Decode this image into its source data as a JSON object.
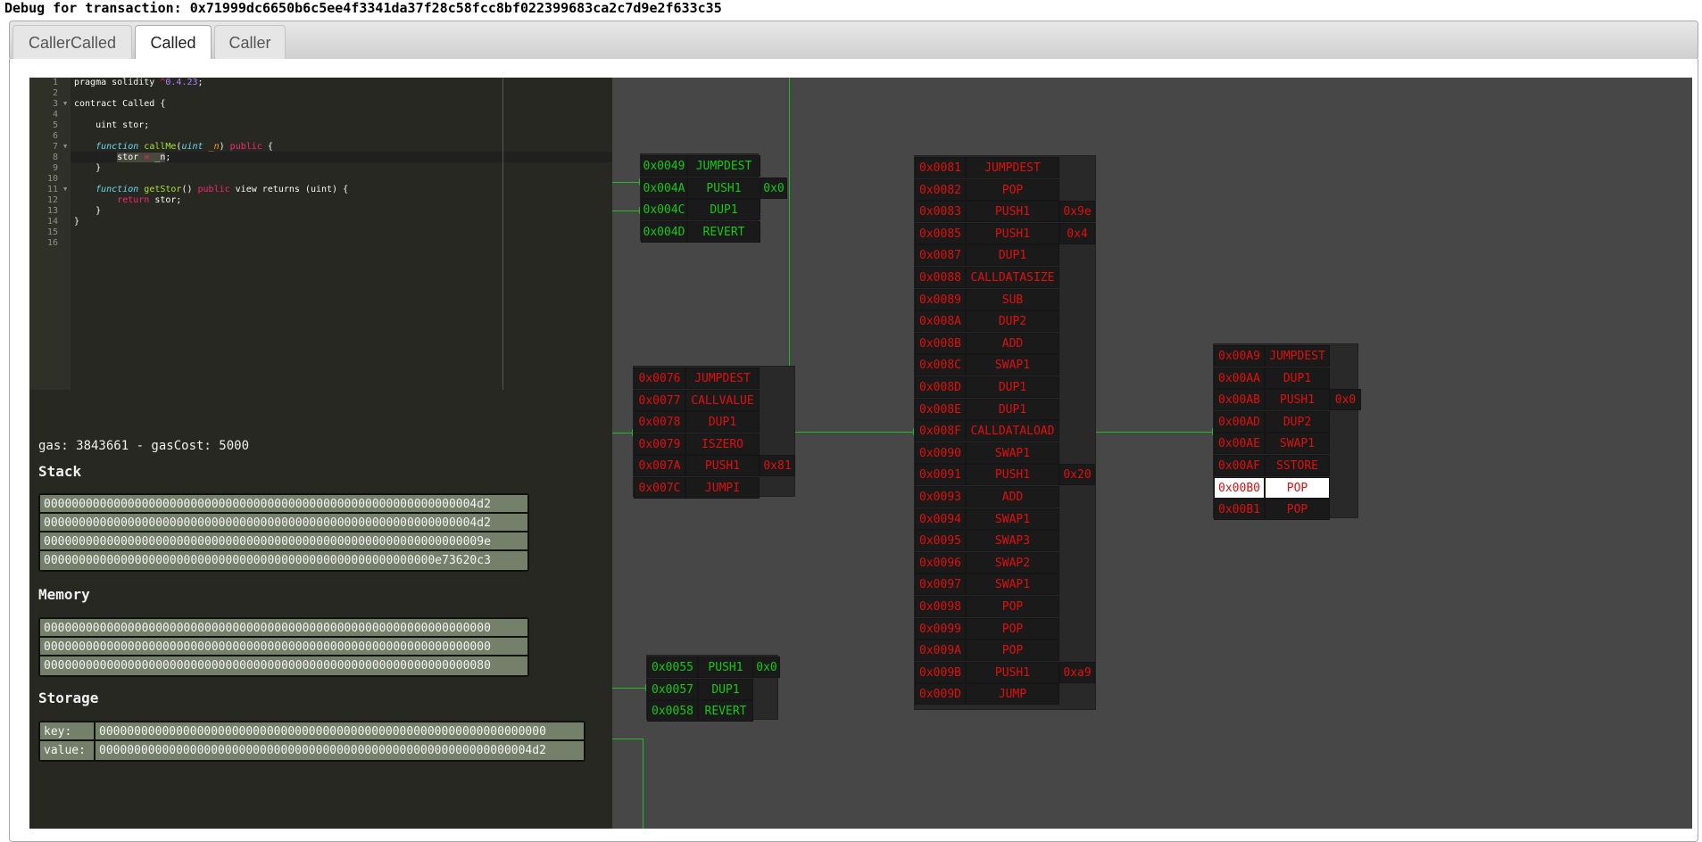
{
  "title": "Debug for transaction: 0x71999dc6650b6c5ee4f3341da37f28c58fcc8bf022399683ca2c7d9e2f633c35",
  "tabs": [
    {
      "label": "CallerCalled",
      "active": false
    },
    {
      "label": "Called",
      "active": true
    },
    {
      "label": "Caller",
      "active": false
    }
  ],
  "editor": {
    "line_numbers": [
      "1",
      "2",
      "3",
      "4",
      "5",
      "6",
      "7",
      "8",
      "9",
      "10",
      "11",
      "12",
      "13",
      "14",
      "15",
      "16"
    ],
    "active_line": 8
  },
  "gas_text": "gas: 3843661 - gasCost: 5000",
  "stack": {
    "heading": "Stack",
    "items": [
      "00000000000000000000000000000000000000000000000000000000000004d2",
      "00000000000000000000000000000000000000000000000000000000000004d2",
      "000000000000000000000000000000000000000000000000000000000000009e",
      "00000000000000000000000000000000000000000000000000000000e73620c3"
    ]
  },
  "memory": {
    "heading": "Memory",
    "items": [
      "0000000000000000000000000000000000000000000000000000000000000000",
      "0000000000000000000000000000000000000000000000000000000000000000",
      "0000000000000000000000000000000000000000000000000000000000000080"
    ]
  },
  "storage": {
    "heading": "Storage",
    "key_label": "key:",
    "key": "0000000000000000000000000000000000000000000000000000000000000000",
    "value_label": "value:",
    "value": "00000000000000000000000000000000000000000000000000000000000004d2"
  },
  "graph": {
    "colors": {
      "visited": "#18c818",
      "current": "#e01010",
      "edge": "#22bb22",
      "background": "#474747"
    },
    "blocks": {
      "b1": [
        {
          "addr": "0x0049",
          "op": "JUMPDEST",
          "arg": ""
        },
        {
          "addr": "0x004A",
          "op": "PUSH1",
          "arg": "0x0"
        },
        {
          "addr": "0x004C",
          "op": "DUP1",
          "arg": ""
        },
        {
          "addr": "0x004D",
          "op": "REVERT",
          "arg": ""
        }
      ],
      "b2": [
        {
          "addr": "0x0076",
          "op": "JUMPDEST",
          "arg": ""
        },
        {
          "addr": "0x0077",
          "op": "CALLVALUE",
          "arg": ""
        },
        {
          "addr": "0x0078",
          "op": "DUP1",
          "arg": ""
        },
        {
          "addr": "0x0079",
          "op": "ISZERO",
          "arg": ""
        },
        {
          "addr": "0x007A",
          "op": "PUSH1",
          "arg": "0x81"
        },
        {
          "addr": "0x007C",
          "op": "JUMPI",
          "arg": ""
        }
      ],
      "b3": [
        {
          "addr": "0x0055",
          "op": "PUSH1",
          "arg": "0x0"
        },
        {
          "addr": "0x0057",
          "op": "DUP1",
          "arg": ""
        },
        {
          "addr": "0x0058",
          "op": "REVERT",
          "arg": ""
        }
      ],
      "b4": [
        {
          "addr": "0x0081",
          "op": "JUMPDEST",
          "arg": ""
        },
        {
          "addr": "0x0082",
          "op": "POP",
          "arg": ""
        },
        {
          "addr": "0x0083",
          "op": "PUSH1",
          "arg": "0x9e"
        },
        {
          "addr": "0x0085",
          "op": "PUSH1",
          "arg": "0x4"
        },
        {
          "addr": "0x0087",
          "op": "DUP1",
          "arg": ""
        },
        {
          "addr": "0x0088",
          "op": "CALLDATASIZE",
          "arg": ""
        },
        {
          "addr": "0x0089",
          "op": "SUB",
          "arg": ""
        },
        {
          "addr": "0x008A",
          "op": "DUP2",
          "arg": ""
        },
        {
          "addr": "0x008B",
          "op": "ADD",
          "arg": ""
        },
        {
          "addr": "0x008C",
          "op": "SWAP1",
          "arg": ""
        },
        {
          "addr": "0x008D",
          "op": "DUP1",
          "arg": ""
        },
        {
          "addr": "0x008E",
          "op": "DUP1",
          "arg": ""
        },
        {
          "addr": "0x008F",
          "op": "CALLDATALOAD",
          "arg": ""
        },
        {
          "addr": "0x0090",
          "op": "SWAP1",
          "arg": ""
        },
        {
          "addr": "0x0091",
          "op": "PUSH1",
          "arg": "0x20"
        },
        {
          "addr": "0x0093",
          "op": "ADD",
          "arg": ""
        },
        {
          "addr": "0x0094",
          "op": "SWAP1",
          "arg": ""
        },
        {
          "addr": "0x0095",
          "op": "SWAP3",
          "arg": ""
        },
        {
          "addr": "0x0096",
          "op": "SWAP2",
          "arg": ""
        },
        {
          "addr": "0x0097",
          "op": "SWAP1",
          "arg": ""
        },
        {
          "addr": "0x0098",
          "op": "POP",
          "arg": ""
        },
        {
          "addr": "0x0099",
          "op": "POP",
          "arg": ""
        },
        {
          "addr": "0x009A",
          "op": "POP",
          "arg": ""
        },
        {
          "addr": "0x009B",
          "op": "PUSH1",
          "arg": "0xa9"
        },
        {
          "addr": "0x009D",
          "op": "JUMP",
          "arg": ""
        }
      ],
      "b5": [
        {
          "addr": "0x00A9",
          "op": "JUMPDEST",
          "arg": ""
        },
        {
          "addr": "0x00AA",
          "op": "DUP1",
          "arg": ""
        },
        {
          "addr": "0x00AB",
          "op": "PUSH1",
          "arg": "0x0"
        },
        {
          "addr": "0x00AD",
          "op": "DUP2",
          "arg": ""
        },
        {
          "addr": "0x00AE",
          "op": "SWAP1",
          "arg": ""
        },
        {
          "addr": "0x00AF",
          "op": "SSTORE",
          "arg": ""
        },
        {
          "addr": "0x00B0",
          "op": "POP",
          "arg": "",
          "current": true
        },
        {
          "addr": "0x00B1",
          "op": "POP",
          "arg": ""
        }
      ]
    }
  }
}
